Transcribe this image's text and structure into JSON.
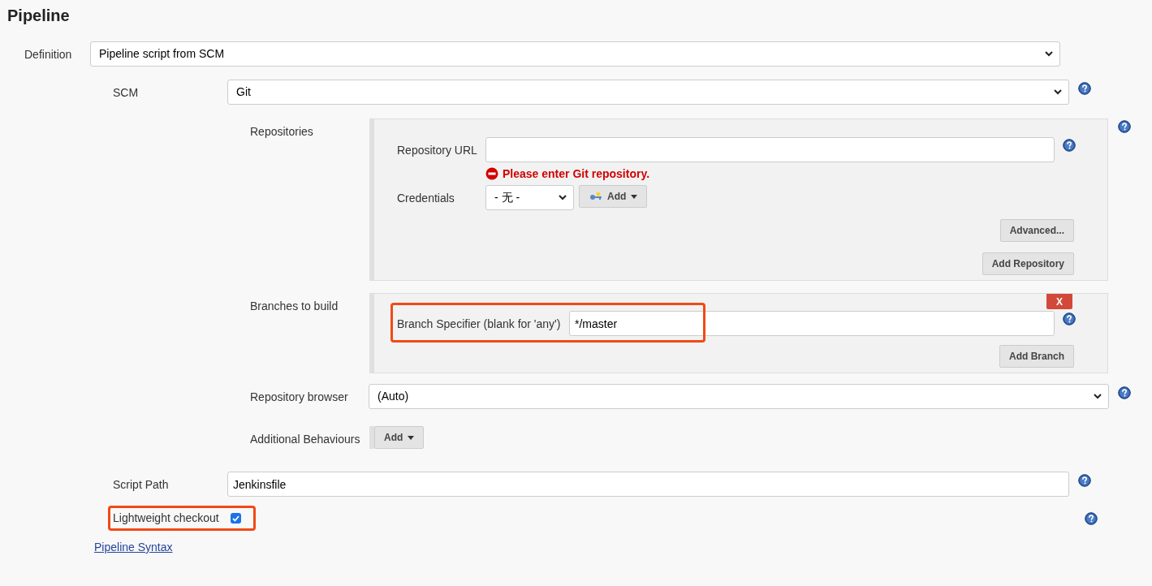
{
  "title": "Pipeline",
  "definition": {
    "label": "Definition",
    "value": "Pipeline script from SCM"
  },
  "scm": {
    "label": "SCM",
    "value": "Git"
  },
  "repositories": {
    "label": "Repositories",
    "url": {
      "label": "Repository URL"
    },
    "error": "Please enter Git repository.",
    "credentials": {
      "label": "Credentials",
      "value": "- 无 -",
      "add_button": "Add"
    },
    "advanced_button": "Advanced...",
    "add_repository_button": "Add Repository"
  },
  "branches": {
    "label": "Branches to build",
    "delete_button": "X",
    "specifier": {
      "label": "Branch Specifier (blank for 'any')",
      "value": "*/master",
      "highlighted": true
    },
    "add_branch_button": "Add Branch"
  },
  "repository_browser": {
    "label": "Repository browser",
    "value": "(Auto)"
  },
  "additional_behaviours": {
    "label": "Additional Behaviours",
    "add_button": "Add"
  },
  "script_path": {
    "label": "Script Path",
    "value": "Jenkinsfile"
  },
  "lightweight_checkout": {
    "label": "Lightweight checkout",
    "checked": true,
    "highlighted": true
  },
  "syntax_link": "Pipeline Syntax"
}
